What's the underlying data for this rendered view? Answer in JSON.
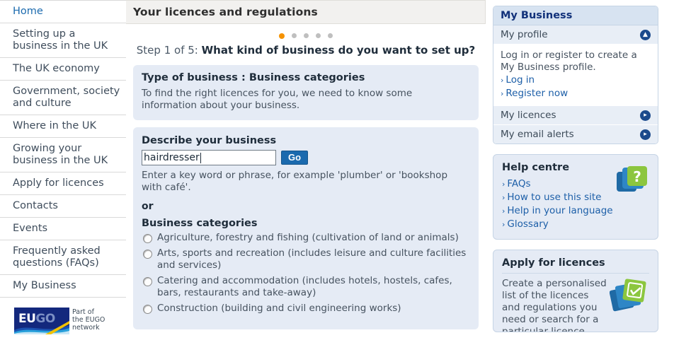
{
  "left_nav": {
    "items": [
      {
        "label": "Home"
      },
      {
        "label": "Setting up a business in the UK"
      },
      {
        "label": "The UK economy"
      },
      {
        "label": "Government, society and culture"
      },
      {
        "label": "Where in the UK"
      },
      {
        "label": "Growing your business in the UK"
      },
      {
        "label": "Apply for licences"
      },
      {
        "label": "Contacts"
      },
      {
        "label": "Events"
      },
      {
        "label": "Frequently asked questions (FAQs)"
      },
      {
        "label": "My Business"
      }
    ],
    "logo": {
      "mark_primary": "EU",
      "mark_secondary": "GO",
      "tagline": "Part of\nthe EUGO\nnetwork",
      "tagline_line1": "Part of",
      "tagline_line2": "the EUGO",
      "tagline_line3": "network"
    }
  },
  "main": {
    "page_title": "Your licences and regulations",
    "steps": {
      "total": 5,
      "current": 1,
      "prefix": "Step 1 of 5:",
      "question": "What kind of business do you want to set up?"
    },
    "type_panel": {
      "title": "Type of business : Business categories",
      "body": "To find the right licences for you, we need to know some information about your business."
    },
    "describe": {
      "title": "Describe your business",
      "input_value": "hairdresser",
      "input_placeholder": "",
      "go_label": "Go",
      "hint": "Enter a key word or phrase, for example 'plumber' or 'bookshop with café'.",
      "or_label": "or",
      "categories_title": "Business categories",
      "categories": [
        "Agriculture, forestry and fishing (cultivation of land or animals)",
        "Arts, sports and recreation (includes leisure and culture facilities and services)",
        "Catering and accommodation (includes hotels, hostels, cafes, bars, restaurants and take-away)",
        "Construction (building and civil engineering works)"
      ]
    }
  },
  "right": {
    "my_business": {
      "title": "My Business",
      "profile_row": "My profile",
      "body": "Log in or register to create a My Business profile.",
      "links": [
        {
          "label": "Log in"
        },
        {
          "label": "Register now"
        }
      ],
      "rows": [
        {
          "label": "My licences"
        },
        {
          "label": "My email alerts"
        }
      ]
    },
    "help_centre": {
      "title": "Help centre",
      "links": [
        {
          "label": "FAQs"
        },
        {
          "label": "How to use this site"
        },
        {
          "label": "Help in your language"
        },
        {
          "label": "Glossary"
        }
      ]
    },
    "apply_licences": {
      "title": "Apply for licences",
      "body": "Create a personalised list of the licences and regulations you need or search for a particular licence directly."
    }
  },
  "colors": {
    "accent_blue": "#1b6aae",
    "panel_blue": "#e5ebf5",
    "step_active": "#f59200",
    "step_inactive": "#bfbfbf",
    "heading_navy": "#11317a",
    "icon_green": "#8cc63f",
    "logo_blue": "#13287d"
  }
}
